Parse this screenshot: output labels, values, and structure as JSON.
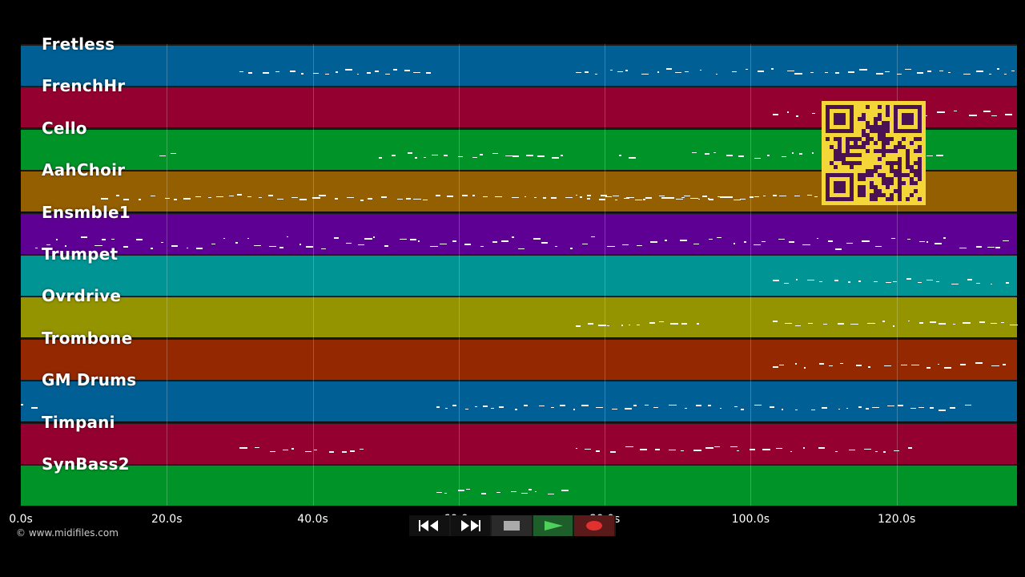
{
  "tracks": [
    {
      "name": "Fretless",
      "color": "#005f94"
    },
    {
      "name": "FrenchHr",
      "color": "#940030"
    },
    {
      "name": "Cello",
      "color": "#009428"
    },
    {
      "name": "AahChoir",
      "color": "#945f00"
    },
    {
      "name": "Ensmble1",
      "color": "#5f0094"
    },
    {
      "name": "Trumpet",
      "color": "#009494"
    },
    {
      "name": "Ovrdrive",
      "color": "#949400"
    },
    {
      "name": "Trombone",
      "color": "#942800"
    },
    {
      "name": "GM Drums",
      "color": "#005f94"
    },
    {
      "name": "Timpani",
      "color": "#940030"
    },
    {
      "name": "SynBass2",
      "color": "#009428"
    }
  ],
  "timeline": {
    "ticks": [
      "0.0s",
      "20.0s",
      "40.0s",
      "60.0s",
      "80.0s",
      "100.0s",
      "120.0s"
    ],
    "max_seconds": 136.5
  },
  "footer": {
    "copyright": "© www.midifiles.com"
  },
  "controls": {
    "rewind_icon": "rewind-icon",
    "forward_icon": "fast-forward-icon",
    "stop_icon": "stop-icon",
    "play_icon": "play-icon",
    "record_icon": "record-icon"
  },
  "overlay": {
    "qr_icon": "qr-code-icon",
    "qr_color": "#f4d639",
    "qr_ink": "#4a1255"
  }
}
